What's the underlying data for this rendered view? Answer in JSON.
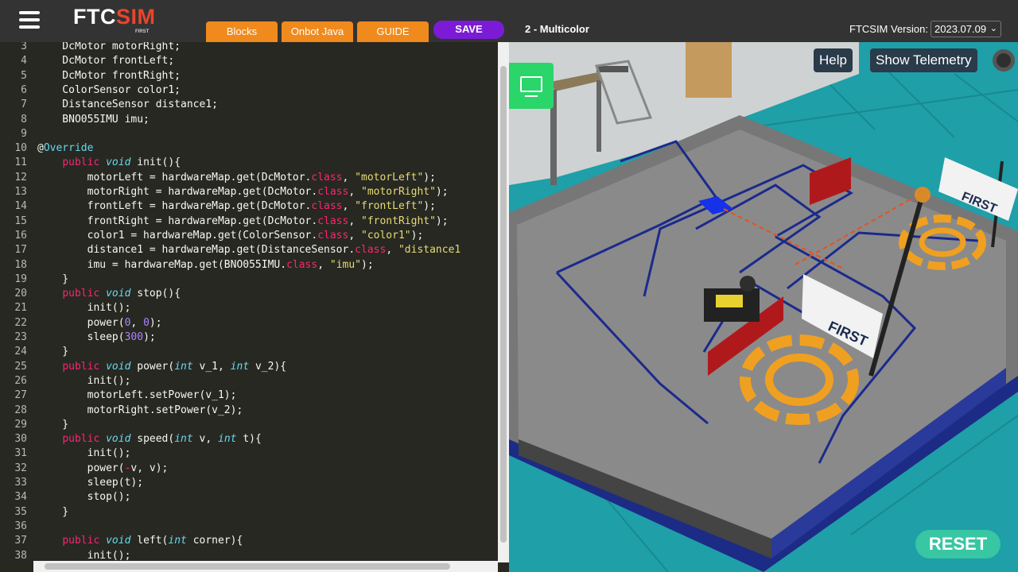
{
  "header": {
    "logo_ftc": "FTC",
    "logo_sim": "SIM",
    "logo_sub": "FIRST",
    "tabs": [
      "Blocks",
      "Onbot Java",
      "GUIDE"
    ],
    "save_label": "SAVE",
    "program_name": "2 - Multicolor",
    "version_label": "FTCSIM Version:",
    "version_value": "2023.07.09"
  },
  "editor": {
    "lines": [
      {
        "n": "3",
        "t": "    DcMotor motorRight;"
      },
      {
        "n": "4",
        "t": "    DcMotor frontLeft;"
      },
      {
        "n": "5",
        "t": "    DcMotor frontRight;"
      },
      {
        "n": "6",
        "t": "    ColorSensor color1;"
      },
      {
        "n": "7",
        "t": "    DistanceSensor distance1;"
      },
      {
        "n": "8",
        "t": "    BNO055IMU imu;"
      },
      {
        "n": "9",
        "t": ""
      },
      {
        "n": "10",
        "t": "@Override"
      },
      {
        "n": "11",
        "t": "    public void init(){"
      },
      {
        "n": "12",
        "t": "        motorLeft = hardwareMap.get(DcMotor.class, \"motorLeft\");"
      },
      {
        "n": "13",
        "t": "        motorRight = hardwareMap.get(DcMotor.class, \"motorRight\");"
      },
      {
        "n": "14",
        "t": "        frontLeft = hardwareMap.get(DcMotor.class, \"frontLeft\");"
      },
      {
        "n": "15",
        "t": "        frontRight = hardwareMap.get(DcMotor.class, \"frontRight\");"
      },
      {
        "n": "16",
        "t": "        color1 = hardwareMap.get(ColorSensor.class, \"color1\");"
      },
      {
        "n": "17",
        "t": "        distance1 = hardwareMap.get(DistanceSensor.class, \"distance1"
      },
      {
        "n": "18",
        "t": "        imu = hardwareMap.get(BNO055IMU.class, \"imu\");"
      },
      {
        "n": "19",
        "t": "    }"
      },
      {
        "n": "20",
        "t": "    public void stop(){"
      },
      {
        "n": "21",
        "t": "        init();"
      },
      {
        "n": "22",
        "t": "        power(0, 0);"
      },
      {
        "n": "23",
        "t": "        sleep(300);"
      },
      {
        "n": "24",
        "t": "    }"
      },
      {
        "n": "25",
        "t": "    public void power(int v_1, int v_2){"
      },
      {
        "n": "26",
        "t": "        init();"
      },
      {
        "n": "27",
        "t": "        motorLeft.setPower(v_1);"
      },
      {
        "n": "28",
        "t": "        motorRight.setPower(v_2);"
      },
      {
        "n": "29",
        "t": "    }"
      },
      {
        "n": "30",
        "t": "    public void speed(int v, int t){"
      },
      {
        "n": "31",
        "t": "        init();"
      },
      {
        "n": "32",
        "t": "        power(-v, v);"
      },
      {
        "n": "33",
        "t": "        sleep(t);"
      },
      {
        "n": "34",
        "t": "        stop();"
      },
      {
        "n": "35",
        "t": "    }"
      },
      {
        "n": "36",
        "t": ""
      },
      {
        "n": "37",
        "t": "    public void left(int corner){"
      },
      {
        "n": "38",
        "t": "        init();"
      }
    ]
  },
  "viewport": {
    "help_label": "Help",
    "telemetry_label": "Show Telemetry",
    "reset_label": "RESET",
    "flag_text": "FIRST",
    "icons": [
      "gear-icon",
      "camera-view-icon"
    ],
    "colors": {
      "floor": "#1f9fa8",
      "field": "#7d7d7d",
      "wall": "#1b2a8c",
      "barrier": "#b0191c",
      "target": "#f0a020"
    }
  }
}
